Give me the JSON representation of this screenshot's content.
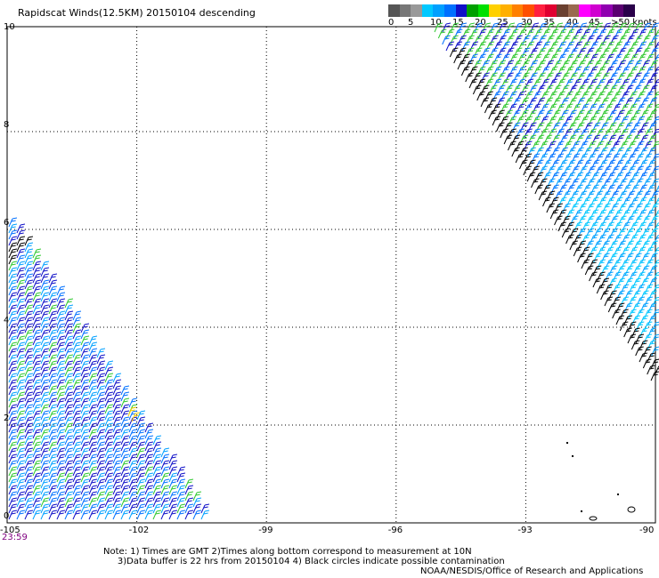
{
  "title": "Rapidscat Winds(12.5KM) 20150104 descending",
  "legend": {
    "colors": [
      "#555555",
      "#777777",
      "#999999",
      "#00c8ff",
      "#00a0ff",
      "#0070ff",
      "#1010c8",
      "#00a000",
      "#00e000",
      "#ffd000",
      "#ffb000",
      "#ff8000",
      "#ff5000",
      "#ff2040",
      "#e00030",
      "#6a4030",
      "#9a6a50",
      "#ff00ff",
      "#d000d0",
      "#9000b0",
      "#5a0070",
      "#2a004a"
    ],
    "labels": [
      "0",
      "5",
      "10",
      "15",
      "20",
      "25",
      "30",
      "35",
      "40",
      "45",
      ">50 knots"
    ]
  },
  "axes": {
    "x_ticks": [
      "-105",
      "-102",
      "-99",
      "-96",
      "-93",
      "-90"
    ],
    "y_ticks": [
      "0",
      "2",
      "4",
      "6",
      "8",
      "10"
    ]
  },
  "time_label": "23:59",
  "notes": [
    "Note: 1) Times are GMT 2)Times along bottom correspond to measurement at 10N",
    "3)Data buffer is 22 hrs from 20150104 4) Black circles indicate possible contamination"
  ],
  "credit": "NOAA/NESDIS/Office of Research and Applications"
}
